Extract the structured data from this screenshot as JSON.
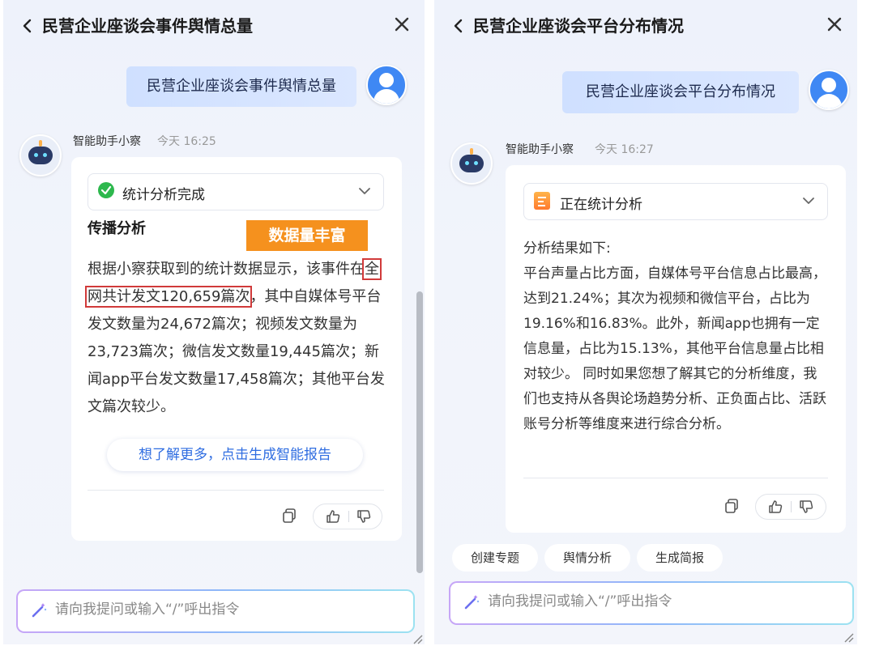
{
  "left_panel": {
    "title": "民营企业座谈会事件舆情总量",
    "back_icon": "chevron-left-icon",
    "close_icon": "close-icon",
    "user_message": "民营企业座谈会事件舆情总量",
    "bot_name": "智能助手小察",
    "bot_time": "今天 16:25",
    "status": "统计分析完成",
    "section_title": "传播分析",
    "tag": "数据量丰富",
    "body_parts": {
      "p1": "根据小察获取到的统计数据显示，该事件在",
      "highlight": "全网共计发文120,659篇次",
      "p2": "，其中自媒体号平台发文数量为24,672篇次；视频发文数量为23,723篇次；微信发文数量19,445篇次；新闻app平台发文数量17,458篇次；其他平台发文篇次较少。"
    },
    "generate_button": "想了解更多，点击生成智能报告",
    "input_placeholder": "请向我提问或输入“/”呼出指令"
  },
  "right_panel": {
    "title": "民营企业座谈会平台分布情况",
    "back_icon": "chevron-left-icon",
    "close_icon": "close-icon",
    "user_message": "民营企业座谈会平台分布情况",
    "bot_name": "智能助手小察",
    "bot_time": "今天 16:27",
    "status": "正在统计分析",
    "body": "分析结果如下:\n平台声量占比方面，自媒体号平台信息占比最高，达到21.24%；其次为视频和微信平台，占比为19.16%和16.83%。此外，新闻app也拥有一定信息量，占比为15.13%，其他平台信息量占比相对较少。 同时如果您想了解其它的分析维度，我们也支持从各舆论场趋势分析、正负面占比、活跃账号分析等维度来进行综合分析。",
    "chips": [
      "创建专题",
      "舆情分析",
      "生成简报"
    ],
    "input_placeholder": "请向我提问或输入“/”呼出指令"
  },
  "colors": {
    "tag_orange": "#f5911e",
    "link_blue": "#2f6de1",
    "success_green": "#2db84d",
    "highlight_red": "#d13a3a"
  }
}
